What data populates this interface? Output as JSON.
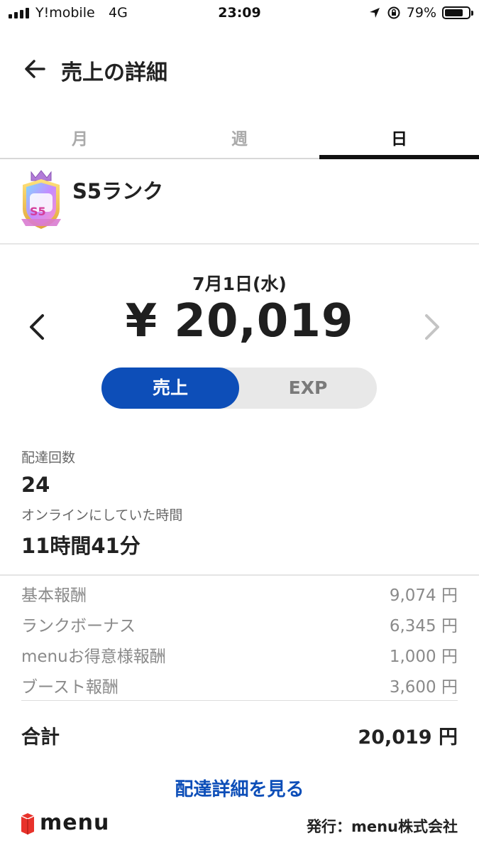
{
  "status_bar": {
    "carrier": "Y!mobile",
    "network": "4G",
    "time": "23:09",
    "battery": "79%",
    "battery_level": 0.79
  },
  "header": {
    "title": "売上の詳細"
  },
  "tabs": [
    {
      "label": "月",
      "active": false
    },
    {
      "label": "週",
      "active": false
    },
    {
      "label": "日",
      "active": true
    }
  ],
  "rank": {
    "name": "S5ランク",
    "badge_text": "S5"
  },
  "summary": {
    "date": "7月1日(水)",
    "amount": "¥ 20,019"
  },
  "toggle": {
    "sales_label": "売上",
    "exp_label": "EXP",
    "selected": "売上"
  },
  "stats": {
    "deliveries_label": "配達回数",
    "deliveries_value": "24",
    "online_label": "オンラインにしていた時間",
    "online_value": "11時間41分"
  },
  "breakdown": [
    {
      "label": "基本報酬",
      "value": "9,074 円"
    },
    {
      "label": "ランクボーナス",
      "value": "6,345 円"
    },
    {
      "label": "menuお得意様報酬",
      "value": "1,000 円"
    },
    {
      "label": "ブースト報酬",
      "value": "3,600 円"
    }
  ],
  "total": {
    "label": "合計",
    "value": "20,019 円"
  },
  "link": {
    "label": "配達詳細を見る"
  },
  "footer": {
    "logo": "menu",
    "publisher": "発行：menu株式会社"
  },
  "colors": {
    "accent": "#0d4eb8",
    "toggle_bg": "#e8e8e8",
    "logo_red": "#e8322b"
  }
}
